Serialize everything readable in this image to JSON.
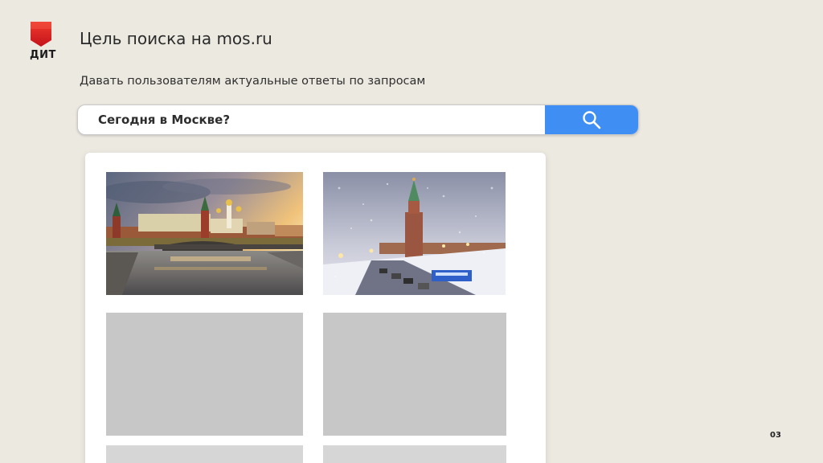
{
  "logo": {
    "text": "ДИТ",
    "color": "#e2231a"
  },
  "title": "Цель поиска на mos.ru",
  "subtitle": "Давать пользователям актуальные ответы по запросам",
  "search": {
    "value": "Сегодня в Москве?",
    "button_icon": "search-icon",
    "button_color": "#3f8ef4"
  },
  "results": {
    "images": [
      {
        "name": "kremlin-river-photo",
        "description_icon": "photo"
      },
      {
        "name": "kremlin-winter-snow-photo",
        "description_icon": "photo"
      }
    ],
    "placeholder_count": 4
  },
  "page_number": "03"
}
